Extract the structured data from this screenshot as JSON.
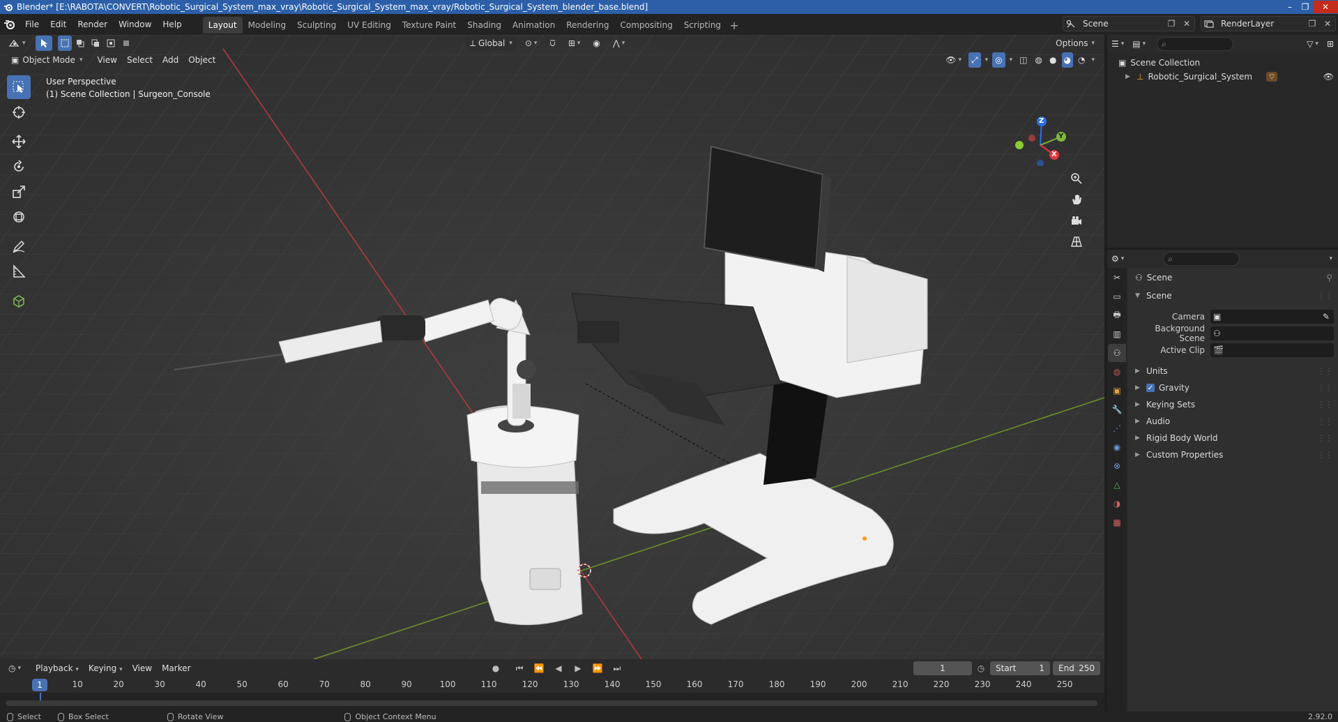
{
  "window": {
    "title": "Blender* [E:\\RABOTA\\CONVERT\\Robotic_Surgical_System_max_vray\\Robotic_Surgical_System_max_vray/Robotic_Surgical_System_blender_base.blend]"
  },
  "menu": [
    "File",
    "Edit",
    "Render",
    "Window",
    "Help"
  ],
  "workspaces": [
    {
      "label": "Layout",
      "active": true
    },
    {
      "label": "Modeling"
    },
    {
      "label": "Sculpting"
    },
    {
      "label": "UV Editing"
    },
    {
      "label": "Texture Paint"
    },
    {
      "label": "Shading"
    },
    {
      "label": "Animation"
    },
    {
      "label": "Rendering"
    },
    {
      "label": "Compositing"
    },
    {
      "label": "Scripting"
    }
  ],
  "scene_selector": {
    "value": "Scene"
  },
  "layer_selector": {
    "value": "RenderLayer"
  },
  "viewport": {
    "transform_orientation": "Global",
    "options_label": "Options",
    "mode": "Object Mode",
    "menus": [
      "View",
      "Select",
      "Add",
      "Object"
    ],
    "perspective": "User Perspective",
    "collection_info": "(1) Scene Collection | Surgeon_Console",
    "gizmo_axes": {
      "z": "Z",
      "y": "Y",
      "x": "X"
    }
  },
  "outliner": {
    "root": "Scene Collection",
    "items": [
      {
        "label": "Robotic_Surgical_System"
      }
    ]
  },
  "properties": {
    "header": "Scene",
    "section": "Scene",
    "fields": [
      {
        "label": "Camera"
      },
      {
        "label": "Background Scene"
      },
      {
        "label": "Active Clip"
      }
    ],
    "panels": [
      {
        "label": "Units"
      },
      {
        "label": "Gravity",
        "checked": true
      },
      {
        "label": "Keying Sets"
      },
      {
        "label": "Audio"
      },
      {
        "label": "Rigid Body World"
      },
      {
        "label": "Custom Properties"
      }
    ]
  },
  "timeline": {
    "menus": [
      "Playback",
      "Keying",
      "View",
      "Marker"
    ],
    "current_frame": "1",
    "start_label": "Start",
    "start": "1",
    "end_label": "End",
    "end": "250",
    "ticks": [
      "10",
      "20",
      "30",
      "40",
      "50",
      "60",
      "70",
      "80",
      "90",
      "100",
      "110",
      "120",
      "130",
      "140",
      "150",
      "160",
      "170",
      "180",
      "190",
      "200",
      "210",
      "220",
      "230",
      "240",
      "250"
    ],
    "cursor_frame": "1"
  },
  "statusbar": {
    "items": [
      "Select",
      "Box Select",
      "Rotate View",
      "Object Context Menu"
    ],
    "version": "2.92.0"
  },
  "colors": {
    "accent": "#4772b3",
    "titlebar": "#2c5fa8",
    "viewport_bg": "#393939"
  }
}
